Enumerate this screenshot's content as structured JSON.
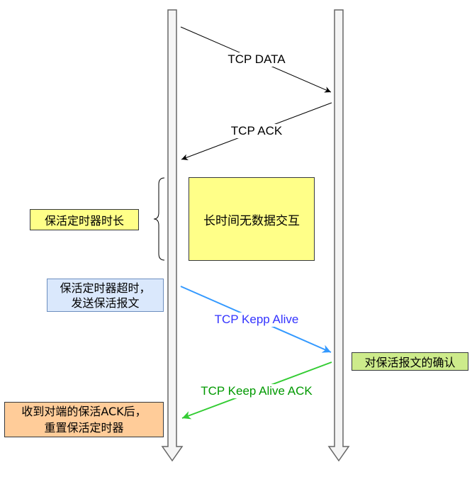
{
  "lifelines": {
    "fill": "#f5f5f5",
    "stroke": "#666666"
  },
  "messages": [
    {
      "label": "TCP DATA",
      "text_color": "#000000",
      "line_color": "#000000"
    },
    {
      "label": "TCP ACK",
      "text_color": "#000000",
      "line_color": "#000000"
    },
    {
      "label": "TCP Kepp Alive",
      "text_color": "#3333ff",
      "line_color": "#3399ff"
    },
    {
      "label": "TCP Keep Alive ACK",
      "text_color": "#009900",
      "line_color": "#33cc33"
    }
  ],
  "notes": {
    "timer_duration": {
      "text": "保活定时器时长",
      "fill": "#ffff88",
      "stroke": "#36393d"
    },
    "idle": {
      "text": "长时间无数据交互",
      "fill": "#ffff88",
      "stroke": "#36393d"
    },
    "timeout": {
      "lines": [
        "保活定时器超时，",
        "发送保活报文"
      ],
      "fill": "#dae8fc",
      "stroke": "#6c8ebf"
    },
    "ack_confirm": {
      "text": "对保活报文的确认",
      "fill": "#cdeb8b",
      "stroke": "#36393d"
    },
    "reset": {
      "lines": [
        "收到对端的保活ACK后，",
        "重置保活定时器"
      ],
      "fill": "#ffcc99",
      "stroke": "#36393d"
    }
  }
}
